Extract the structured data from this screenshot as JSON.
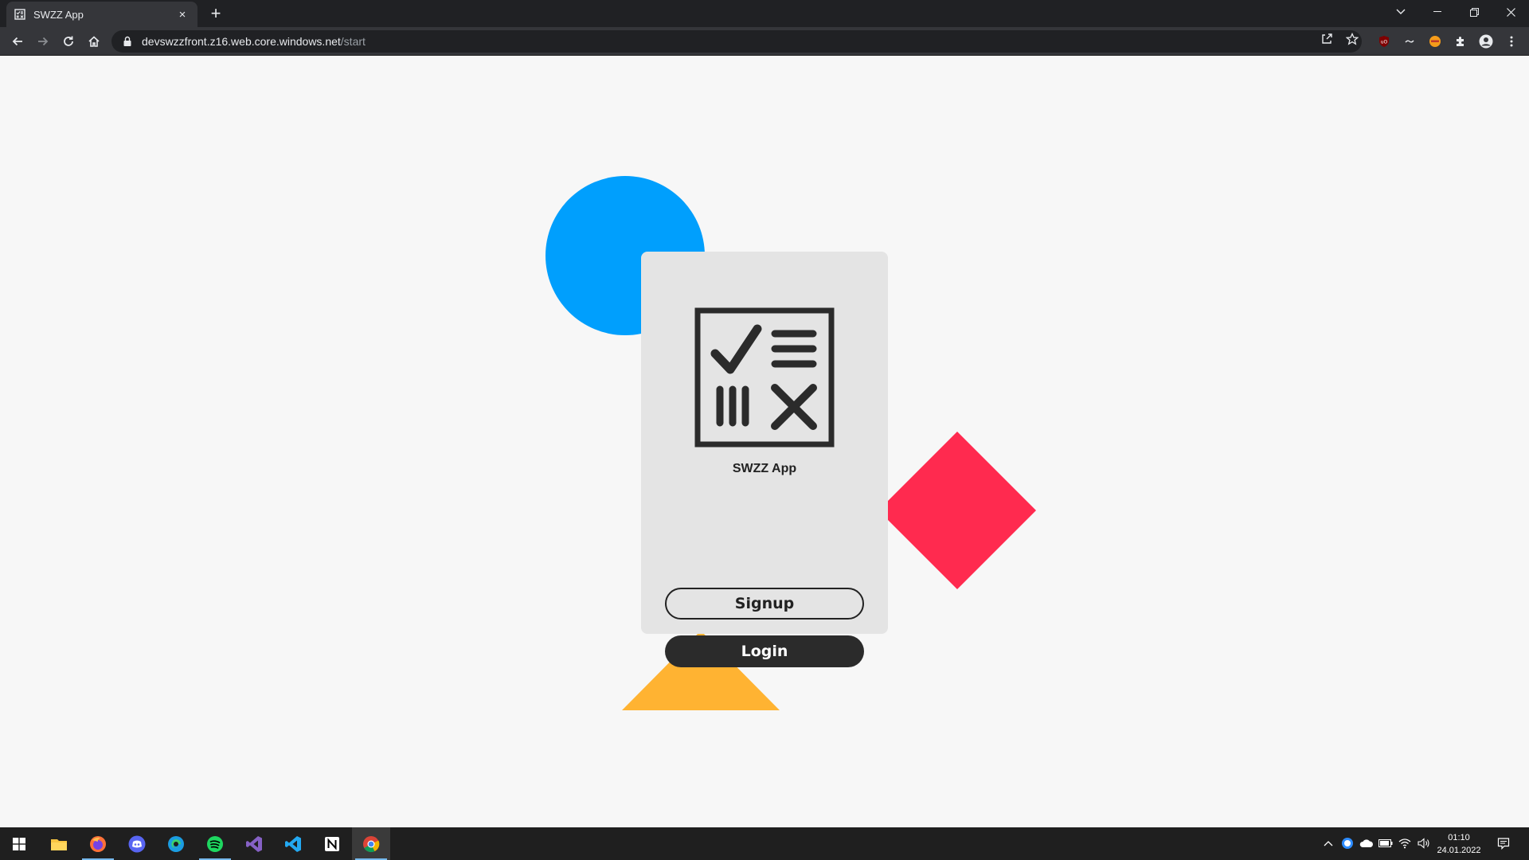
{
  "browser": {
    "tab_title": "SWZZ App",
    "tab_close": "×",
    "new_tab": "+",
    "url_host": "devswzzfront.z16.web.core.windows.net",
    "url_path": "/start"
  },
  "page": {
    "app_name": "SWZZ App",
    "signup_label": "Signup",
    "login_label": "Login"
  },
  "colors": {
    "circle": "#009ffd",
    "diamond": "#ff2a4f",
    "triangle": "#ffb332",
    "card": "#e4e4e4",
    "login_button": "#2b2b2b"
  },
  "taskbar": {
    "time": "01:10",
    "date": "24.01.2022",
    "apps": [
      "windows-start",
      "file-explorer",
      "firefox",
      "discord",
      "edge",
      "spotify",
      "visual-studio",
      "vscode",
      "notion",
      "chrome"
    ]
  }
}
